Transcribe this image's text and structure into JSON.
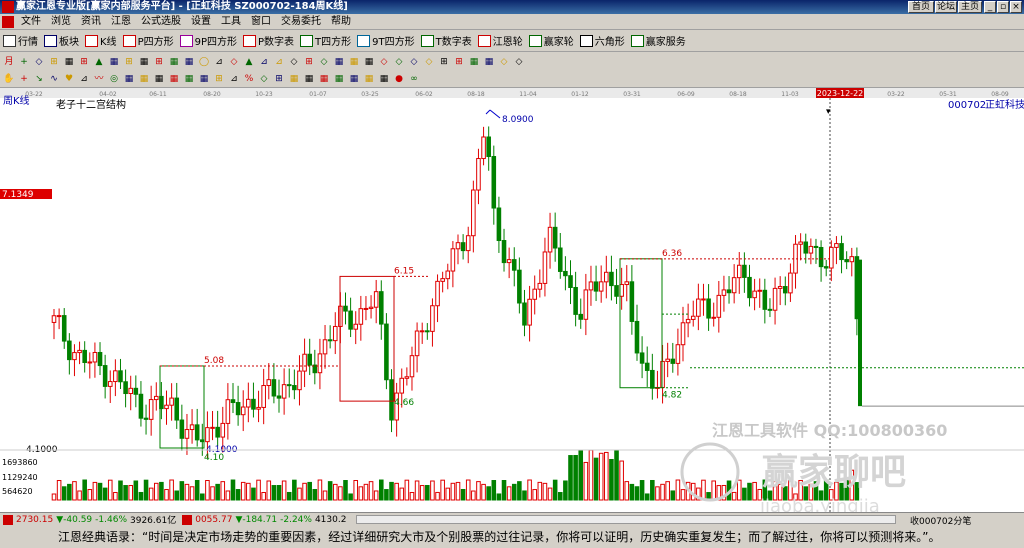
{
  "titlebar": {
    "title": "赢家江恩专业版[赢家内部服务平台] - [正虹科技  SZ000702-184周K线]",
    "btn_home": "首页",
    "btn_forum": "论坛",
    "btn_main": "主页"
  },
  "menu": [
    "文件",
    "浏览",
    "资讯",
    "江恩",
    "公式选股",
    "设置",
    "工具",
    "窗口",
    "交易委托",
    "帮助"
  ],
  "toolbar1": [
    "行情",
    "板块",
    "K线",
    "P四方形",
    "9P四方形",
    "P数字表",
    "T四方形",
    "9T四方形",
    "T数字表",
    "江恩轮",
    "赢家轮",
    "六角形",
    "赢家服务"
  ],
  "toolbar2_row1": [
    "月",
    "+",
    "◇",
    "⊞",
    "▦",
    "⊞",
    "▲",
    "▦",
    "⊞",
    "▦",
    "⊞",
    "▦",
    "▦",
    "◯",
    "⊿",
    "◇",
    "▲",
    "⊿",
    "⊿",
    "◇",
    "⊞",
    "◇",
    "▦",
    "▦",
    "▦",
    "◇",
    "◇",
    "◇",
    "◇",
    "⊞",
    "⊞",
    "▦",
    "▦",
    "◇",
    "◇"
  ],
  "toolbar2_row2": [
    "✋",
    "+",
    "↘",
    "∿",
    "♥",
    "⊿",
    "〰",
    "◎",
    "▦",
    "▦",
    "▦",
    "▦",
    "▦",
    "▦",
    "⊞",
    "⊿",
    "%",
    "◇",
    "⊞",
    "▦",
    "▦",
    "▦",
    "▦",
    "▦",
    "▦",
    "▦",
    "●",
    "∞"
  ],
  "date_ticks": [
    "03-22",
    "04-02",
    "06-11",
    "08-20",
    "10-23",
    "01-07",
    "03-25",
    "06-02",
    "08-18",
    "11-04",
    "01-12",
    "03-31",
    "06-09",
    "08-18",
    "11-03",
    "2023-12-22",
    "03-22",
    "05-31",
    "08-09"
  ],
  "chart": {
    "period_label": "周K线",
    "structure_label": "老子十二宫结构",
    "stock_code": "000702",
    "stock_name": "正虹科技",
    "price_marker": "7.1349",
    "label_high": "8.0900",
    "label_low": "4.1000",
    "label_axis_low": "4.1000",
    "box1_top": "5.08",
    "box1_bottom": "4.10",
    "box2_top": "6.15",
    "box2_bottom": "4.66",
    "box3_top": "6.36",
    "box3_bottom": "4.82",
    "vol_ticks": [
      "1693860",
      "1129240",
      "564620"
    ],
    "current_date": "2023-12-22"
  },
  "watermark": {
    "line1": "江恩工具软件  QQ:100800360",
    "line2": "赢家聊吧",
    "line3": "jiaoba.yingjia"
  },
  "status": {
    "sh_index": "2730.15",
    "sh_change": "▼-40.59",
    "sh_pct": "-1.46%",
    "sh_amount": "3926.61亿",
    "sz_index": "0055.77",
    "sz_change": "▼-184.71",
    "sz_pct": "-2.24%",
    "sz_amount": "4130.2",
    "right_text": "收000702分笔"
  },
  "quote": "江恩经典语录：“时间是决定市场走势的重要因素，经过详细研究大市及个别股票的过往记录，你将可以证明，历史确实重复发生；而了解过往，你将可以预测将来。”。",
  "colors": {
    "up": "#e00000",
    "down": "#008000",
    "box_red": "#cc0000",
    "box_green": "#008000",
    "high_line": "#0000cc"
  }
}
